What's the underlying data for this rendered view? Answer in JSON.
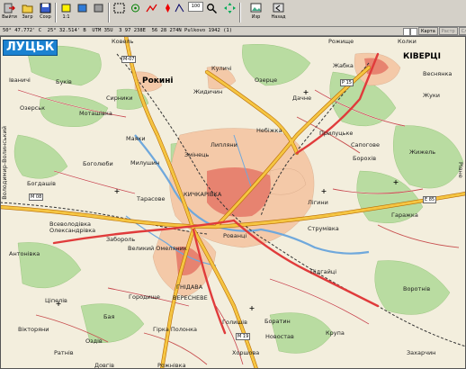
{
  "toolbar": {
    "buttons": [
      {
        "name": "exit-button",
        "label": "Выйти",
        "icon": "exit-icon"
      },
      {
        "name": "load-button",
        "label": "Загр",
        "icon": "open-folder-icon"
      },
      {
        "name": "save-button",
        "label": "Сохр",
        "icon": "save-icon"
      },
      {
        "name": "layer-a-button",
        "label": "1:1",
        "icon": "layer-icon"
      },
      {
        "name": "layer-b-button",
        "label": "",
        "icon": "layer-icon"
      },
      {
        "name": "layer-c-button",
        "label": "",
        "icon": "layer-icon"
      },
      {
        "name": "select-button",
        "label": "",
        "icon": "select-icon"
      },
      {
        "name": "gps-button",
        "label": "",
        "icon": "gps-icon"
      },
      {
        "name": "track-button",
        "label": "",
        "icon": "track-icon"
      },
      {
        "name": "waypoints-button",
        "label": "",
        "icon": "waypoint-icon"
      },
      {
        "name": "route-button",
        "label": "",
        "icon": "route-icon"
      },
      {
        "name": "search-button",
        "label": "",
        "icon": "search-icon"
      },
      {
        "name": "image-button",
        "label": "Изр",
        "icon": "image-icon"
      },
      {
        "name": "view-button",
        "label": "Назад",
        "icon": "back-icon"
      }
    ],
    "zoom_value": "100"
  },
  "status": {
    "lat": "50° 47.772' С",
    "lon": "25° 32.514' В",
    "system": "UTM",
    "zone": "35U",
    "easting": "3 97 238E",
    "northing": "56 28 274N",
    "datum": "Pulkovo 1942 (1)"
  },
  "tabs": [
    "Карта",
    "Растр",
    "Слои"
  ],
  "map": {
    "city_badge": "ЛУЦЬК",
    "labels": {
      "kovel": "Ковель",
      "rozhyshche": "Рожище",
      "kolky": "Колки",
      "kivertsi": "КІВЕРЦІ",
      "rokyni": "Рокині",
      "ivanychi": "Іваничі",
      "bukiv": "Буків",
      "ozeriany": "Озерськ",
      "motashivka": "Моташівка",
      "syrnyky": "Сирники",
      "kulychi": "Куличі",
      "zhydychyn": "Жидичин",
      "ozertse": "Озерце",
      "zhabka": "Жабка",
      "dachne": "Дачне",
      "vesnianka": "Веснянка",
      "zhuky": "Жуки",
      "nebizhka": "Небіжка",
      "prylutske": "Прилуцьке",
      "sapohove": "Сапогове",
      "zhytel": "Жижель",
      "makky": "Маяки",
      "lypliany": "Липляни",
      "yarosh": "Ярошівка",
      "boholiuby": "Боголюби",
      "milushyn": "Милушин",
      "zminets": "Змінець",
      "borokhiv": "Борохів",
      "proskury": "Прокури",
      "boholiuby2": "Богдашів",
      "tarasove": "Тарасове",
      "kychkarivka": "КИЧКАРІВКА",
      "lyhyni": "Лігини",
      "harazhka": "Гаражка",
      "pidgaitsi": "Підгайці",
      "vsevolodivka": "Всеволодівка",
      "oleksandrivka": "Олександрівка",
      "zaboral": "Забороль",
      "velykyi_omelianyk": "Великий Омеляник",
      "rovantsi": "Рованці",
      "strumivka": "Струмівка",
      "antonivka": "Антонівка",
      "podgaitsi": "Підгайці",
      "tsepiv": "Ціпелів",
      "horodyshche": "Городище",
      "vereshchane": "ВЕРЕСНЕВЕ",
      "hnidava": "ГНІДАВА",
      "vorotnie": "Воротнів",
      "viktoriany": "Вікторяни",
      "baia": "Бая",
      "ozdiv": "Оздів",
      "hirka_polonka": "Гірка Полонка",
      "holyshiv": "Голишів",
      "boratyn": "Боратин",
      "novostav": "Новостав",
      "krupa": "Крупа",
      "horshova": "Хоршова",
      "zaharchyn": "Захарчин",
      "ratniv": "Ратнів",
      "volodymyr": "Володимир-Волинський",
      "rivne": "Рівне",
      "dovhiv": "Довгів",
      "boratyn2": "Горохів",
      "rozhnivka": "Рожнівка",
      "m07": "М-07",
      "m08": "М 08",
      "p15": "Р 15",
      "m19": "М 19",
      "e85": "Е 85"
    }
  }
}
